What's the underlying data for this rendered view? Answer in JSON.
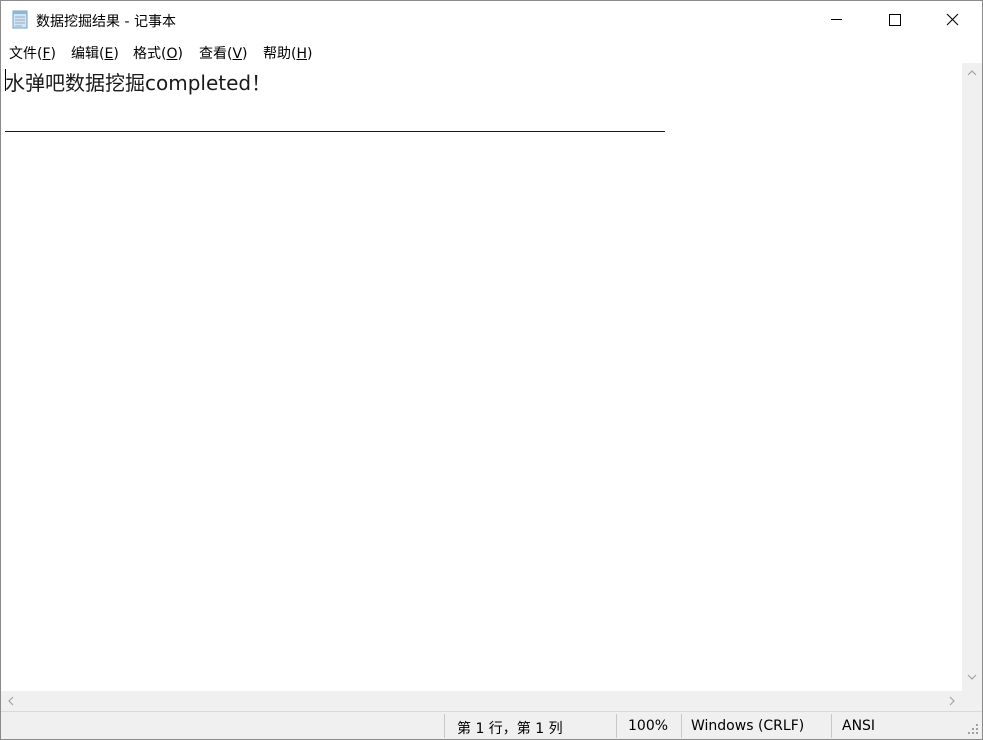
{
  "window": {
    "title": "数据挖掘结果 - 记事本"
  },
  "title_buttons": {
    "minimize_icon": "minimize-icon",
    "maximize_icon": "maximize-icon",
    "close_icon": "close-icon"
  },
  "menu": {
    "items": [
      {
        "label": "文件(",
        "accel": "F",
        "suffix": ")"
      },
      {
        "label": "编辑(",
        "accel": "E",
        "suffix": ")"
      },
      {
        "label": "格式(",
        "accel": "O",
        "suffix": ")"
      },
      {
        "label": "查看(",
        "accel": "V",
        "suffix": ")"
      },
      {
        "label": "帮助(",
        "accel": "H",
        "suffix": ")"
      }
    ]
  },
  "document": {
    "line1": "水弹吧数据挖掘completed！",
    "line2_rule": "horizontal underscore line"
  },
  "status": {
    "position": "第 1 行，第 1 列",
    "zoom": "100%",
    "line_ending": "Windows (CRLF)",
    "encoding": "ANSI"
  },
  "colors": {
    "background": "#ffffff",
    "scrollbar": "#f0f0f0",
    "statusbar": "#f0f0f0",
    "text": "#000000"
  }
}
